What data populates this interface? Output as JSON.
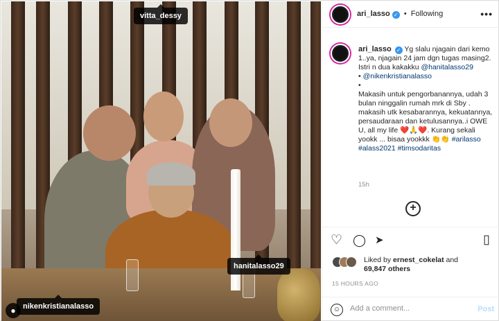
{
  "photo": {
    "tags": [
      "vitta_dessy",
      "hanitalasso29",
      "nikenkristianalasso"
    ],
    "user_tag_icon": "person-icon"
  },
  "header": {
    "username": "ari_lasso",
    "verified_badge": "✓",
    "separator": "•",
    "follow_label": "Following",
    "more_label": "•••"
  },
  "caption": {
    "username": "ari_lasso",
    "line1": "Yg slalu njagain dari kemo 1..ya, njagain 24 jam dgn tugas masing2. Istri n dua kakakku ",
    "mention1": "@hanitalasso29",
    "mention2": "@nikenkristianalasso",
    "bullet1": "•",
    "bullet2": "•",
    "body": "Makasih untuk pengorbanannya, udah 3 bulan ninggalin rumah mrk di Sby . makasih utk kesabarannya, kekuatannya, persaudaraan dan ketulusannya..i OWE U, all my life ❤️🙏❤️. Kurang sekali yookk ... bisaa yookkk 👏👏 ",
    "hashtags": "#arilasso #alass2021 #timsodaritas",
    "time_ago": "15h"
  },
  "actions": {
    "like_icon": "♡",
    "comment_icon": "◯",
    "share_icon": "➤",
    "save_icon": "▯",
    "add_icon": "+"
  },
  "likes": {
    "prefix": "Liked by ",
    "user": "ernest_cokelat",
    "middle": " and ",
    "count": "69,847 others"
  },
  "date": "15 HOURS AGO",
  "comment": {
    "emoji_icon": "☺",
    "placeholder": "Add a comment...",
    "post_label": "Post"
  },
  "colors": {
    "accent": "#3897f0",
    "mention": "#00376b",
    "muted": "#8e8e8e",
    "post_disabled": "#b2dffc"
  }
}
